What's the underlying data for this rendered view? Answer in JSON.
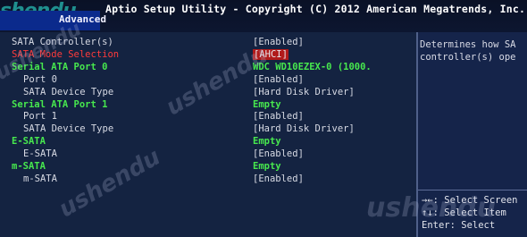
{
  "header": {
    "title": "Aptio Setup Utility - Copyright (C) 2012 American Megatrends, Inc.",
    "active_tab": "Advanced"
  },
  "settings": [
    {
      "label": "SATA Controller(s)",
      "value": "[Enabled]",
      "indent": 0,
      "style": "white"
    },
    {
      "label": "SATA Mode Selection",
      "value": "[AHCI]",
      "indent": 0,
      "style": "selected"
    },
    {
      "label": "Serial ATA Port 0",
      "value": "WDC WD10EZEX-0 (1000.",
      "indent": 0,
      "style": "green"
    },
    {
      "label": "Port 0",
      "value": "[Enabled]",
      "indent": 1,
      "style": "white"
    },
    {
      "label": "SATA Device Type",
      "value": "[Hard Disk Driver]",
      "indent": 1,
      "style": "white"
    },
    {
      "label": "Serial ATA Port 1",
      "value": "Empty",
      "indent": 0,
      "style": "green"
    },
    {
      "label": "Port 1",
      "value": "[Enabled]",
      "indent": 1,
      "style": "white"
    },
    {
      "label": "SATA Device Type",
      "value": "[Hard Disk Driver]",
      "indent": 1,
      "style": "white"
    },
    {
      "label": "E-SATA",
      "value": "Empty",
      "indent": 0,
      "style": "green"
    },
    {
      "label": "E-SATA",
      "value": "[Enabled]",
      "indent": 1,
      "style": "white"
    },
    {
      "label": "m-SATA",
      "value": "Empty",
      "indent": 0,
      "style": "green"
    },
    {
      "label": "m-SATA",
      "value": "[Enabled]",
      "indent": 1,
      "style": "white"
    }
  ],
  "help": {
    "line1": "Determines how SA",
    "line2": "controller(s) ope"
  },
  "keys": {
    "line1": "→←: Select Screen",
    "line2": "↑↓: Select Item",
    "line3": "Enter: Select"
  },
  "watermark": {
    "logo": "shendu",
    "text1": "ushendu",
    "text2": "ushendu",
    "text3": "ushendu",
    "text4": "ushendu"
  },
  "colors": {
    "background": "#142341",
    "header": "#0c1630",
    "tab": "#0b2a8c",
    "green": "#47e84e",
    "selected_label": "#ff3b3b",
    "selected_value_bg": "#b01a1a"
  }
}
